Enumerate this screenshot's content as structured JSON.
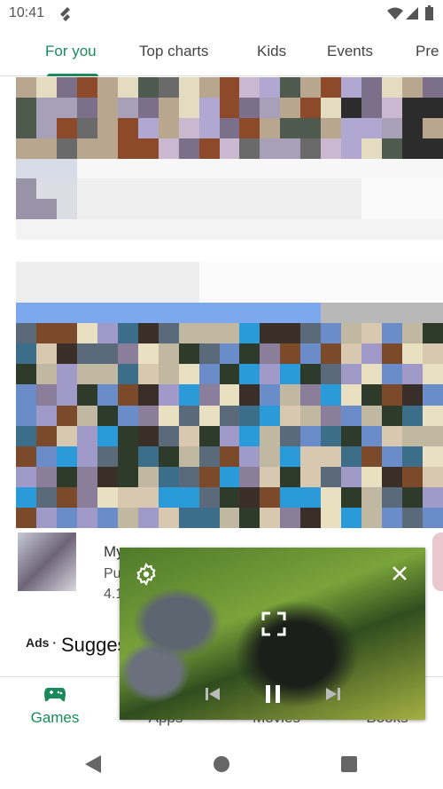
{
  "status_bar": {
    "time": "10:41"
  },
  "tabs": [
    {
      "label": "For you",
      "active": true
    },
    {
      "label": "Top charts"
    },
    {
      "label": "Kids"
    },
    {
      "label": "Events"
    },
    {
      "label": "Pre"
    }
  ],
  "app_row": {
    "title": "My",
    "publisher": "Pu",
    "rating": "4.1"
  },
  "section": {
    "ads_label": "Ads ·",
    "title": "Sugges"
  },
  "bottom_nav": [
    {
      "label": "Games",
      "active": true
    },
    {
      "label": "Apps"
    },
    {
      "label": "Movies"
    },
    {
      "label": "Books"
    }
  ],
  "video_player": {
    "controls": [
      "settings-icon",
      "close-icon",
      "fullscreen-icon",
      "previous-icon",
      "pause-icon",
      "next-icon"
    ]
  },
  "colors": {
    "accent": "#1a8a5a"
  }
}
